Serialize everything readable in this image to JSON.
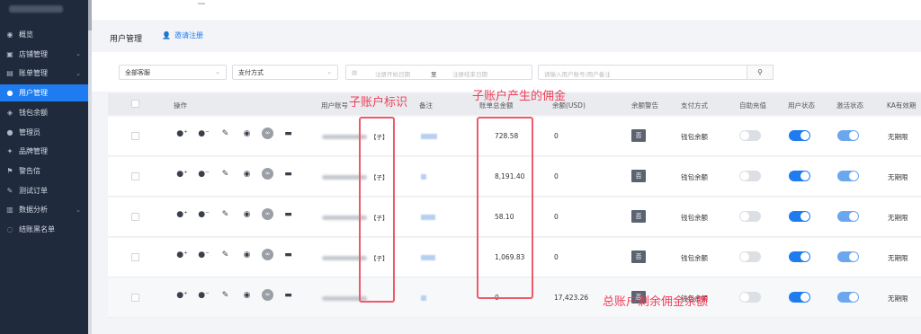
{
  "sidebar": {
    "items": [
      {
        "label": "概览",
        "icon": "dashboard-icon",
        "has_arrow": false
      },
      {
        "label": "店铺管理",
        "icon": "store-icon",
        "has_arrow": true
      },
      {
        "label": "账单管理",
        "icon": "bill-icon",
        "has_arrow": true
      },
      {
        "label": "用户管理",
        "icon": "user-icon",
        "has_arrow": false,
        "active": true
      },
      {
        "label": "钱包余额",
        "icon": "wallet-icon",
        "has_arrow": false
      },
      {
        "label": "管理员",
        "icon": "admin-icon",
        "has_arrow": false
      },
      {
        "label": "品牌管理",
        "icon": "brand-icon",
        "has_arrow": false
      },
      {
        "label": "警告信",
        "icon": "flag-icon",
        "has_arrow": false
      },
      {
        "label": "测试订单",
        "icon": "wrench-icon",
        "has_arrow": false
      },
      {
        "label": "数据分析",
        "icon": "chart-icon",
        "has_arrow": true
      },
      {
        "label": "结账黑名单",
        "icon": "blacklist-icon",
        "has_arrow": false
      }
    ]
  },
  "header": {
    "title": "用户管理",
    "invite_label": "邀请注册"
  },
  "filters": {
    "group_select": "全部客服",
    "pay_select": "支付方式",
    "date_start_placeholder": "注册开始日期",
    "date_sep": "至",
    "date_end_placeholder": "注册结束日期",
    "search_placeholder": "请输入用户账号/用户备注"
  },
  "table": {
    "headers": {
      "ops": "操作",
      "account": "用户账号",
      "note": "备注",
      "bill_total": "账单总金额",
      "balance": "余额(USD)",
      "balance_warn": "余额警告",
      "pay_method": "支付方式",
      "auto_recharge": "自助充值",
      "user_status": "用户状态",
      "activation": "激活状态",
      "ka_valid": "KA有效期"
    },
    "rows": [
      {
        "sub_tag": "【子】",
        "bill_total": "728.58",
        "balance": "0",
        "warn": "否",
        "pay_method": "钱包余额",
        "ka_valid": "无期限",
        "note_width": 18
      },
      {
        "sub_tag": "【子】",
        "bill_total": "8,191.40",
        "balance": "0",
        "warn": "否",
        "pay_method": "钱包余额",
        "ka_valid": "无期限",
        "note_width": 6
      },
      {
        "sub_tag": "【子】",
        "bill_total": "58.10",
        "balance": "0",
        "warn": "否",
        "pay_method": "钱包余额",
        "ka_valid": "无期限",
        "note_width": 16
      },
      {
        "sub_tag": "【子】",
        "bill_total": "1,069.83",
        "balance": "0",
        "warn": "否",
        "pay_method": "钱包余额",
        "ka_valid": "无期限",
        "note_width": 16
      },
      {
        "sub_tag": "",
        "bill_total": "0",
        "balance": "17,423.26",
        "warn": "否",
        "pay_method": "钱包余额",
        "ka_valid": "无期限",
        "note_width": 6
      }
    ]
  },
  "annotations": {
    "sub_account_mark": "子账户标识",
    "sub_commission": "子账户产生的佣金",
    "main_remaining": "总账户剩余佣金余额"
  },
  "colors": {
    "accent": "#1e7cf0",
    "sidebar_bg": "#1f2a3d",
    "annotation": "#f03f59"
  }
}
